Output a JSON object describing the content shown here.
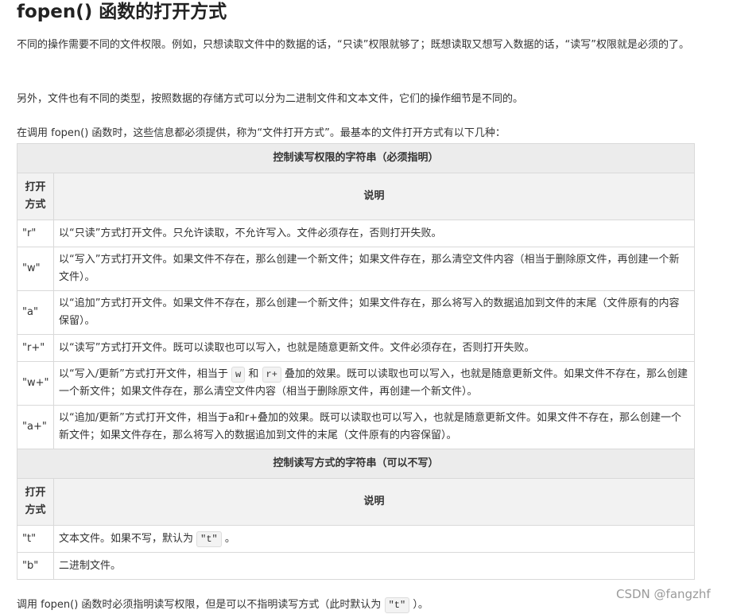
{
  "title": "fopen() 函数的打开方式",
  "paragraphs": [
    "不同的操作需要不同的文件权限。例如，只想读取文件中的数据的话，“只读”权限就够了；既想读取又想写入数据的话，“读写”权限就是必须的了。",
    "另外，文件也有不同的类型，按照数据的存储方式可以分为二进制文件和文本文件，它们的操作细节是不同的。",
    "在调用 fopen() 函数时，这些信息都必须提供，称为“文件打开方式”。最基本的文件打开方式有以下几种："
  ],
  "table": {
    "section1_title": "控制读写权限的字符串（必须指明）",
    "section2_title": "控制读写方式的字符串（可以不写）",
    "col_mode_line1": "打开",
    "col_mode_line2": "方式",
    "col_desc": "说明",
    "rows1": [
      {
        "mode": "\"r\"",
        "desc": "以“只读”方式打开文件。只允许读取，不允许写入。文件必须存在，否则打开失败。"
      },
      {
        "mode": "\"w\"",
        "desc": "以“写入”方式打开文件。如果文件不存在，那么创建一个新文件；如果文件存在，那么清空文件内容（相当于删除原文件，再创建一个新文件）。"
      },
      {
        "mode": "\"a\"",
        "desc": "以“追加”方式打开文件。如果文件不存在，那么创建一个新文件；如果文件存在，那么将写入的数据追加到文件的末尾（文件原有的内容保留）。"
      },
      {
        "mode": "\"r+\"",
        "desc": "以“读写”方式打开文件。既可以读取也可以写入，也就是随意更新文件。文件必须存在，否则打开失败。"
      },
      {
        "mode": "\"w+\"",
        "desc_a": "以“写入/更新”方式打开文件，相当于",
        "code_w": "w",
        "desc_and": "和",
        "code_rplus": "r+",
        "desc_b": "叠加的效果。既可以读取也可以写入，也就是随意更新文件。如果文件不存在，那么创建一个新文件；如果文件存在，那么清空文件内容（相当于删除原文件，再创建一个新文件）。"
      },
      {
        "mode": "\"a+\"",
        "desc": "以“追加/更新”方式打开文件，相当于a和r+叠加的效果。既可以读取也可以写入，也就是随意更新文件。如果文件不存在，那么创建一个新文件；如果文件存在，那么将写入的数据追加到文件的末尾（文件原有的内容保留）。"
      }
    ],
    "rows2": [
      {
        "mode": "\"t\"",
        "desc_a": "文本文件。如果不写，默认为",
        "code": "\"t\"",
        "desc_b": "。"
      },
      {
        "mode": "\"b\"",
        "desc": "二进制文件。"
      }
    ]
  },
  "footer": {
    "text_a": "调用 fopen() 函数时必须指明读写权限，但是可以不指明读写方式（此时默认为",
    "code": "\"t\"",
    "text_b": "）。"
  },
  "watermark": "CSDN @fangzhf"
}
